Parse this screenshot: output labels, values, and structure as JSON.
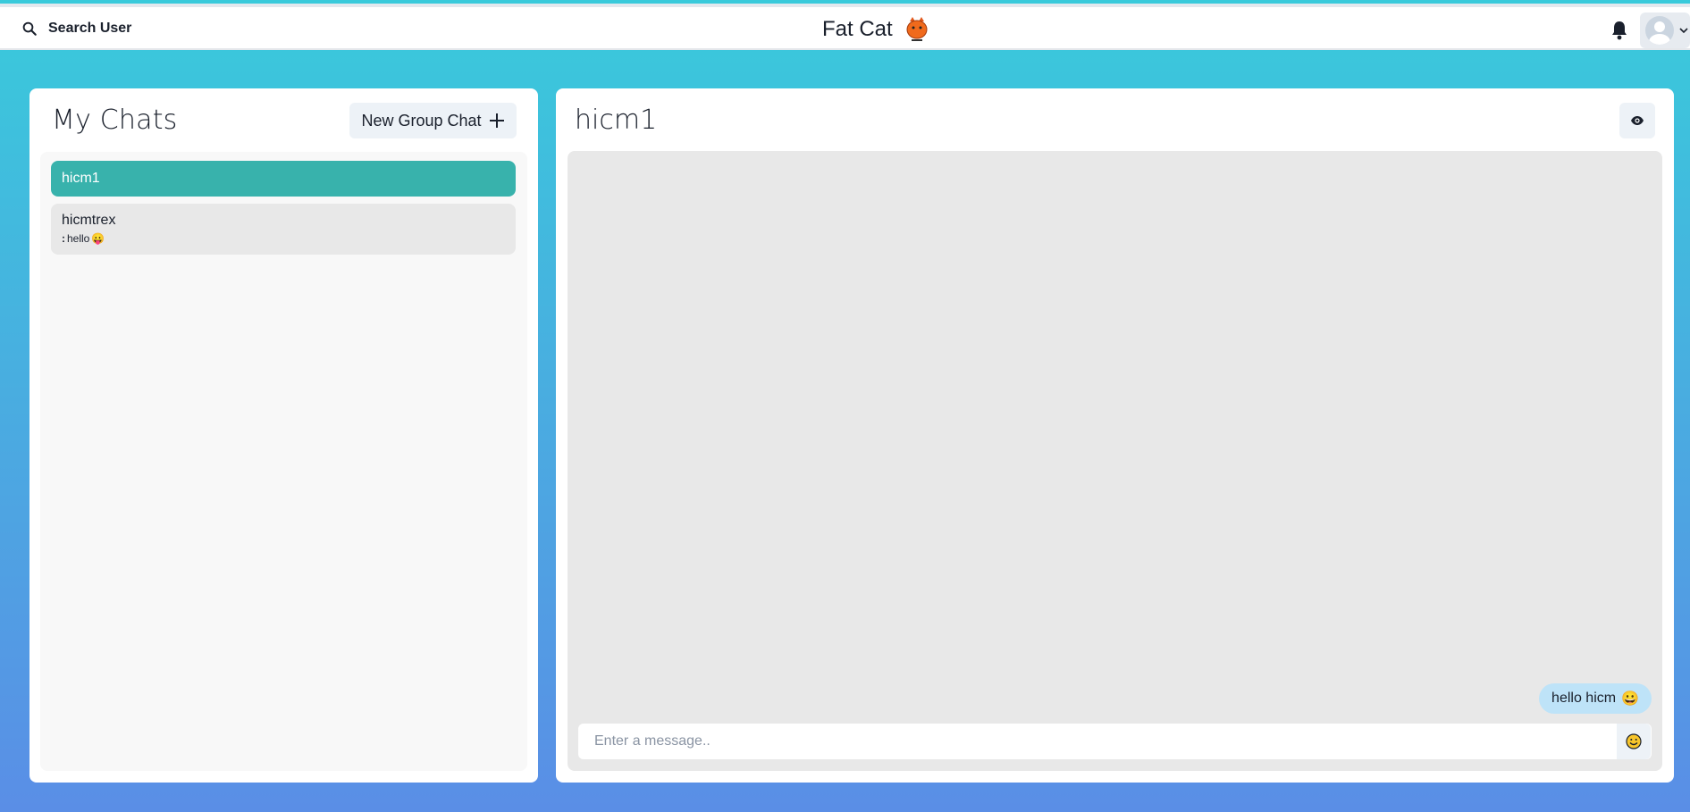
{
  "topbar": {
    "search_label": "Search User",
    "brand_title": "Fat Cat",
    "icons": {
      "search": "search-icon",
      "bell": "bell-icon",
      "avatar": "avatar-icon",
      "chevron": "chevron-down-icon"
    }
  },
  "sidebar": {
    "title": "My Chats",
    "new_group_label": "New Group Chat",
    "chats": [
      {
        "name": "hicm1",
        "active": true
      },
      {
        "name": "hicmtrex",
        "preview_sender": ":",
        "preview_text": "hello",
        "preview_emoji": "😛"
      }
    ]
  },
  "chat": {
    "title": "hicm1",
    "messages": [
      {
        "text": "hello hicm",
        "emoji": "😀",
        "mine": true
      }
    ],
    "input_placeholder": "Enter a message.."
  },
  "colors": {
    "accent": "#38b2ac",
    "bubble": "#bee3f8",
    "background_top": "#39cadb",
    "background_bottom": "#5a8ee6"
  }
}
